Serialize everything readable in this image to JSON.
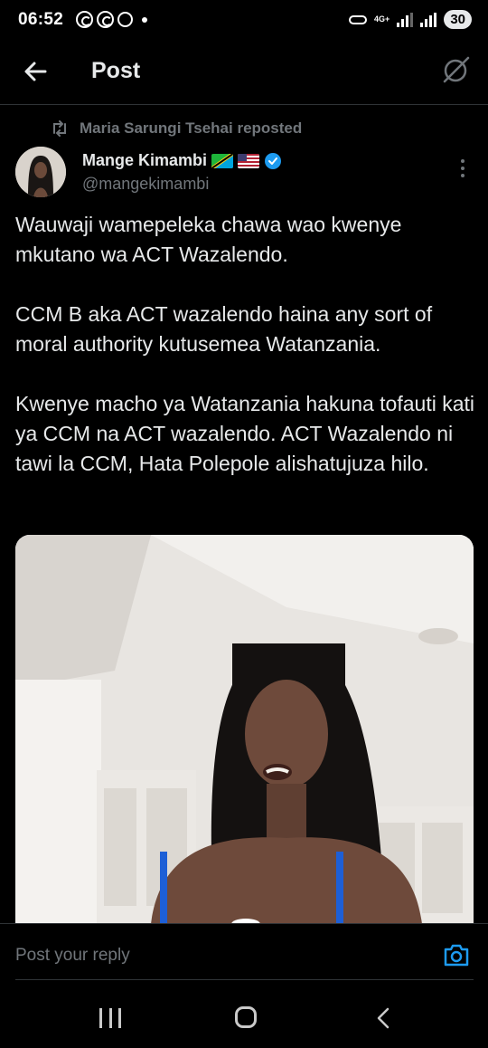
{
  "status_bar": {
    "time": "06:52",
    "network": "4G+",
    "battery": "30"
  },
  "header": {
    "title": "Post"
  },
  "repost": {
    "text": "Maria Sarungi Tsehai reposted"
  },
  "author": {
    "name": "Mange Kimambi",
    "handle": "@mangekimambi"
  },
  "tweet": {
    "paragraphs": [
      "Wauwaji wamepeleka chawa wao kwenye mkutano wa ACT Wazalendo.",
      "CCM B aka ACT wazalendo haina any sort of moral authority kutusemea Watanzania.",
      "Kwenye macho ya Watanzania hakuna tofauti kati ya CCM na ACT wazalendo. ACT Wazalendo ni tawi la CCM, Hata Polepole alishatujuza hilo."
    ]
  },
  "reply": {
    "placeholder": "Post your reply"
  },
  "colors": {
    "background": "#000000",
    "text": "#e7e9ea",
    "muted": "#71767b",
    "accent": "#1d9bf0",
    "divider": "#2f3336"
  },
  "icons": [
    "back-arrow-icon",
    "grok-icon",
    "repost-icon",
    "verified-icon",
    "more-icon",
    "camera-icon",
    "nav-recent-icon",
    "nav-home-icon",
    "nav-back-icon"
  ]
}
